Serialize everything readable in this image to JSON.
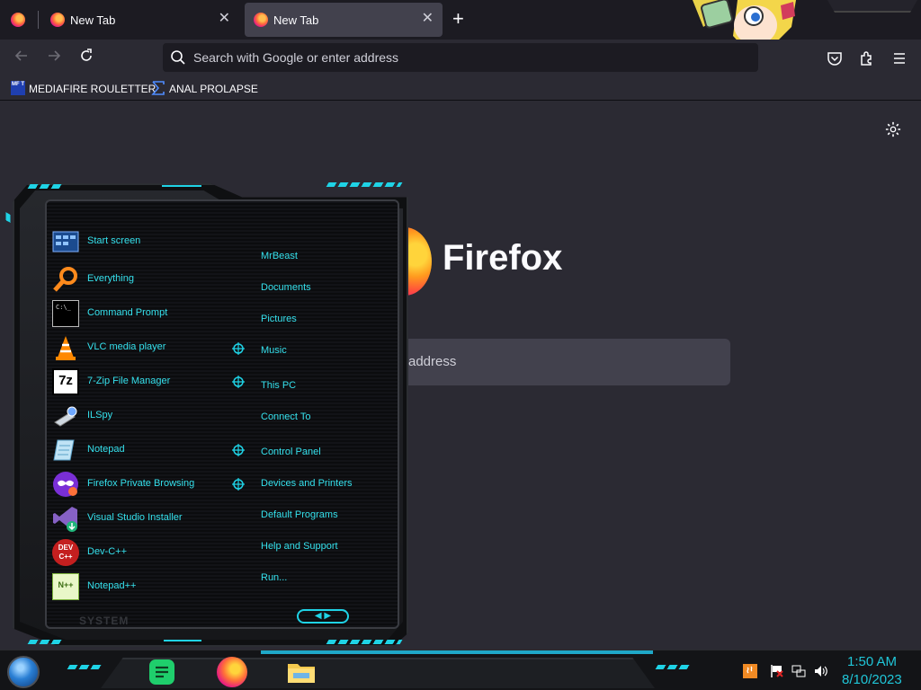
{
  "browser": {
    "tabs": [
      {
        "label": "New Tab",
        "active": false
      },
      {
        "label": "New Tab",
        "active": true
      }
    ],
    "new_tab_symbol": "+",
    "close_symbol": "✕",
    "urlbar": {
      "placeholder": "Search with Google or enter address"
    },
    "bookmarks": [
      {
        "label": "MEDIAFIRE ROULETTER",
        "icon": "mediafire-icon",
        "icon_text": "MF T"
      },
      {
        "label": "ANAL PROLAPSE",
        "icon": "sigma-icon"
      }
    ]
  },
  "newtab": {
    "wordmark": "Firefox",
    "search_partial_text": "address"
  },
  "start_menu": {
    "programs": [
      {
        "label": "Start screen",
        "icon": "start-screen-icon"
      },
      {
        "label": "Everything",
        "icon": "magnifier-icon"
      },
      {
        "label": "Command Prompt",
        "icon": "cmd-icon"
      },
      {
        "label": "VLC media player",
        "icon": "vlc-cone-icon"
      },
      {
        "label": "7-Zip File Manager",
        "icon": "7zip-icon"
      },
      {
        "label": "ILSpy",
        "icon": "ilspy-icon"
      },
      {
        "label": "Notepad",
        "icon": "notepad-icon"
      },
      {
        "label": "Firefox Private Browsing",
        "icon": "private-browsing-icon"
      },
      {
        "label": "Visual Studio Installer",
        "icon": "vs-installer-icon"
      },
      {
        "label": "Dev-C++",
        "icon": "devcpp-icon"
      },
      {
        "label": "Notepad++",
        "icon": "notepadpp-icon"
      }
    ],
    "places": [
      {
        "label": "MrBeast"
      },
      {
        "label": "Documents"
      },
      {
        "label": "Pictures"
      },
      {
        "label": "Music"
      },
      {
        "label": "This PC"
      },
      {
        "label": "Connect To"
      },
      {
        "label": "Control Panel"
      },
      {
        "label": "Devices and Printers"
      },
      {
        "label": "Default Programs"
      },
      {
        "label": "Help and Support"
      },
      {
        "label": "Run..."
      }
    ],
    "footer_label": "SYSTEM",
    "cmd_icon_text": "C:\\_",
    "zip_icon_text": "7z",
    "dev_icon_text": "DEV C++",
    "npp_icon_text": "N++",
    "accent_color": "#1fd3e6"
  },
  "taskbar": {
    "clock_time": "1:50 AM",
    "clock_date": "8/10/2023",
    "apps": [
      "notes-icon",
      "firefox-icon",
      "file-explorer-icon"
    ],
    "tray": [
      "java-icon",
      "action-center-flag-icon",
      "network-icon",
      "volume-icon"
    ]
  }
}
